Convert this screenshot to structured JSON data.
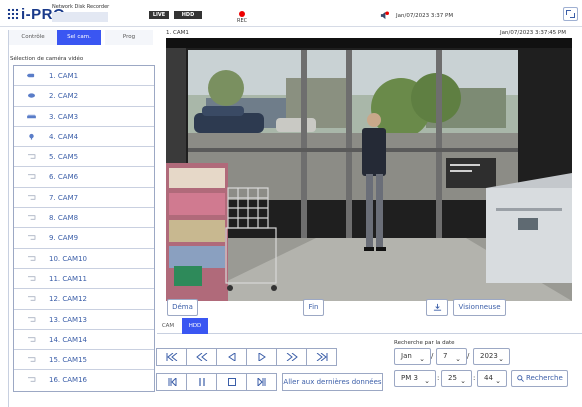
{
  "header": {
    "brand": "i-PRO",
    "product": "Network Disk Recorder",
    "live_label": "LIVE",
    "hdd_label": "HDD",
    "rec_label": "REC",
    "datetime": "Jan/07/2023 3:37 PM"
  },
  "sidebar": {
    "tabs": [
      "Contrôle",
      "Sel cam.",
      "Prog"
    ],
    "title": "Sélection de caméra vidéo",
    "cameras": [
      "1. CAM1",
      "2. CAM2",
      "3. CAM3",
      "4. CAM4",
      "5. CAM5",
      "6. CAM6",
      "7. CAM7",
      "8. CAM8",
      "9. CAM9",
      "10. CAM10",
      "11. CAM11",
      "12. CAM12",
      "13. CAM13",
      "14. CAM14",
      "15. CAM15",
      "16. CAM16"
    ]
  },
  "player": {
    "camera_title": "1. CAM1",
    "timestamp": "Jan/07/2023 3:37:45 PM",
    "start_label": "Déma",
    "end_label": "Fin",
    "viewer_label": "Visionneuse"
  },
  "modes": [
    "CAM",
    "HDD"
  ],
  "controls": {
    "go_latest_label": "Aller aux dernières données"
  },
  "search": {
    "label": "Recherche par la date",
    "month": "Jan",
    "day": "7",
    "year": "2023",
    "ampm_hour": "PM 3",
    "minute": "25",
    "second": "44",
    "separator": "/",
    "time_separator": ":",
    "button_label": "Recherche"
  },
  "colors": {
    "accent": "#3a56f2",
    "rec": "#e00000",
    "brand": "#1a3a8a"
  }
}
